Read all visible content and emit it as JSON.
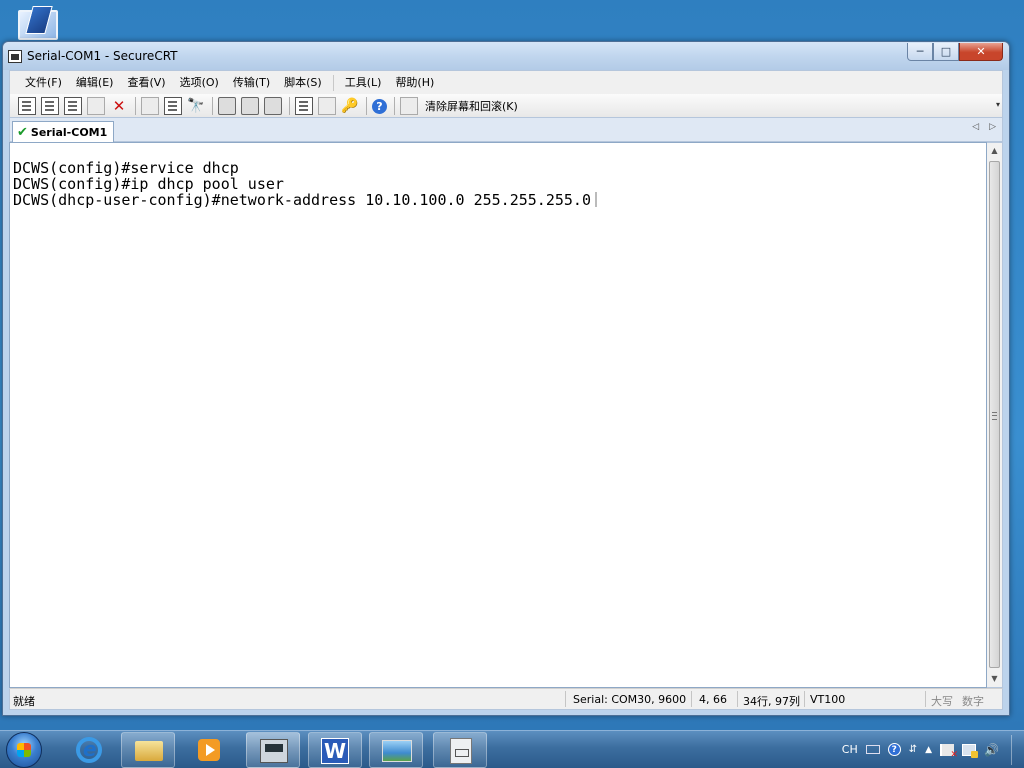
{
  "window": {
    "title": "Serial-COM1 - SecureCRT",
    "controls": {
      "minimize": "─",
      "maximize": "□",
      "close": "✕"
    }
  },
  "menu": {
    "items": [
      "文件(F)",
      "编辑(E)",
      "查看(V)",
      "选项(O)",
      "传输(T)",
      "脚本(S)",
      "工具(L)",
      "帮助(H)"
    ]
  },
  "toolbar": {
    "clear_label": "清除屏幕和回滚(K)",
    "help_glyph": "?",
    "find_glyph": "🔭",
    "key_glyph": "🔑",
    "disconnect_glyph": "✕",
    "dropdown_glyph": "▾"
  },
  "tabs": {
    "active_label": "Serial-COM1",
    "check_glyph": "✔",
    "prev_glyph": "◁",
    "next_glyph": "▷"
  },
  "terminal": {
    "lines": [
      "DCWS(config)#service dhcp",
      "DCWS(config)#ip dhcp pool user",
      "DCWS(dhcp-user-config)#network-address 10.10.100.0 255.255.255.0"
    ]
  },
  "scroll": {
    "up_glyph": "▲",
    "down_glyph": "▼"
  },
  "status": {
    "ready": "就绪",
    "serial": "Serial: COM30, 9600",
    "cursor_pos": "4,  66",
    "size": "34行, 97列",
    "emulation": "VT100",
    "caps": "大写",
    "num": "数字"
  },
  "tray": {
    "lang": "CH",
    "help_glyph": "?",
    "arrow_glyph": "▲",
    "volume_glyph": "🔊"
  },
  "colors": {
    "desktop": "#3d8bc7",
    "taskbar": "#3c6e9f",
    "close_button": "#c8452b",
    "terminal_bg": "#ffffff"
  },
  "icons": [
    "computer-icon",
    "app-icon",
    "check-icon",
    "help-icon",
    "start-icon",
    "ie-icon",
    "folder-icon",
    "media-player-icon",
    "securecrt-icon",
    "word-icon",
    "image-viewer-icon",
    "document-icon"
  ]
}
